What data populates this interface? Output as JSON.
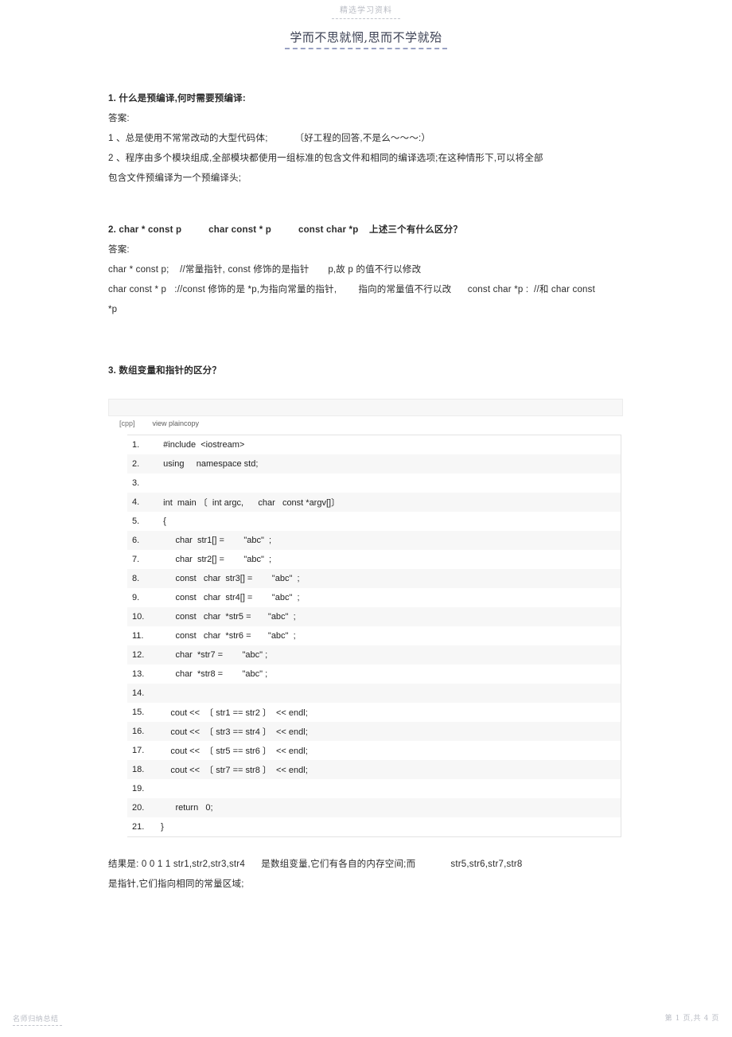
{
  "watermark": {
    "header_text": "精选学习资料",
    "footer_left": "名师归纳总结",
    "footer_right": "第 1 页,共 4 页"
  },
  "doc": {
    "title": "学而不思就惘,思而不学就殆"
  },
  "sections": [
    {
      "id": "q1",
      "question": "1. 什么是预编译,何时需要预编译:",
      "answer_label": "答案:",
      "answer_lines": [
        "1 、总是使用不常常改动的大型代码体;          〔好工程的回答,不是么～～～:）",
        "2 、程序由多个模块组成,全部模块都使用一组标准的包含文件和相同的编译选项;在这种情形下,可以将全部",
        "包含文件预编译为一个预编译头;"
      ]
    },
    {
      "id": "q2",
      "question": "2. char * const p          char const * p          const char *p    上述三个有什么区分？",
      "answer_label": "答案:",
      "answer_lines": [
        "char * const p;    //常量指针, const 修饰的是指针       p,故 p 的值不行以修改",
        "char const * p   ://const 修饰的是 *p,为指向常量的指针,        指向的常量值不行以改      const char *p :  //和 char const",
        "*p"
      ]
    },
    {
      "id": "q3",
      "question": "3. 数组变量和指针的区分？",
      "conclusion_lines": [
        "结果是: 0 0 1 1 str1,str2,str3,str4      是数组变量,它们有各自的内存空间;而             str5,str6,str7,str8",
        "是指针,它们指向相同的常量区域;"
      ]
    }
  ],
  "code_toolbar": {
    "language": "[cpp]",
    "view_label": "view plaincopy"
  },
  "code_block": {
    "accent_color": "#5fd35f",
    "lines": [
      {
        "num": "1.",
        "text": "   #include  <iostream>"
      },
      {
        "num": "2.",
        "text": "   using     namespace std;"
      },
      {
        "num": "3.",
        "text": ""
      },
      {
        "num": "4.",
        "text": "   int  main 〔  int argc,      char   const *argv[]〕"
      },
      {
        "num": "5.",
        "text": "   {"
      },
      {
        "num": "6.",
        "text": "        char  str1[] =        \"abc\"  ;"
      },
      {
        "num": "7.",
        "text": "        char  str2[] =        \"abc\"  ;"
      },
      {
        "num": "8.",
        "text": "        const   char  str3[] =        \"abc\"  ;"
      },
      {
        "num": "9.",
        "text": "        const   char  str4[] =        \"abc\"  ;"
      },
      {
        "num": "10.",
        "text": "        const   char  *str5 =       \"abc\"  ;"
      },
      {
        "num": "11.",
        "text": "        const   char  *str6 =       \"abc\"  ;"
      },
      {
        "num": "12.",
        "text": "        char  *str7 =        \"abc\" ;"
      },
      {
        "num": "13.",
        "text": "        char  *str8 =        \"abc\" ;"
      },
      {
        "num": "14.",
        "text": ""
      },
      {
        "num": "15.",
        "text": "      cout <<  〔 str1 == str2 〕  << endl;"
      },
      {
        "num": "16.",
        "text": "      cout <<  〔 str3 == str4 〕  << endl;"
      },
      {
        "num": "17.",
        "text": "      cout <<  〔 str5 == str6 〕  << endl;"
      },
      {
        "num": "18.",
        "text": "      cout <<  〔 str7 == str8 〕  << endl;"
      },
      {
        "num": "19.",
        "text": ""
      },
      {
        "num": "20.",
        "text": "        return   0;"
      },
      {
        "num": "21.",
        "text": "  }"
      }
    ]
  }
}
